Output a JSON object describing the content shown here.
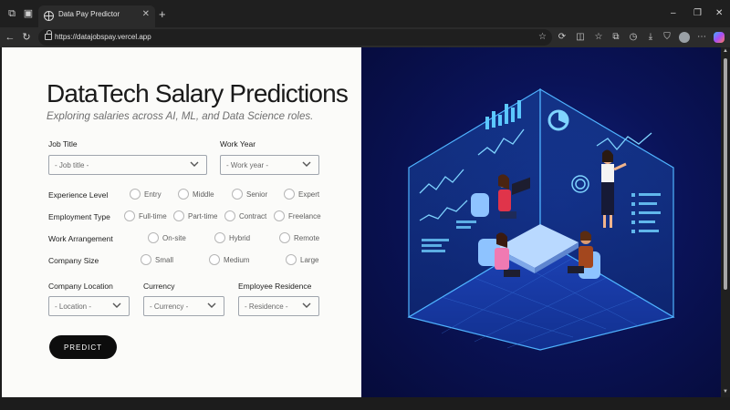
{
  "browser": {
    "tab_title": "Data Pay Predictor",
    "url": "https://datajobspay.vercel.app"
  },
  "page": {
    "title": "DataTech Salary Predictions",
    "subtitle": "Exploring salaries across AI, ML, and Data Science roles.",
    "job_title": {
      "label": "Job Title",
      "placeholder": "- Job title -"
    },
    "work_year": {
      "label": "Work Year",
      "placeholder": "- Work year -"
    },
    "experience": {
      "label": "Experience Level",
      "options": [
        "Entry",
        "Middle",
        "Senior",
        "Expert"
      ]
    },
    "employment": {
      "label": "Employment Type",
      "options": [
        "Full-time",
        "Part-time",
        "Contract",
        "Freelance"
      ]
    },
    "arrangement": {
      "label": "Work Arrangement",
      "options": [
        "On-site",
        "Hybrid",
        "Remote"
      ]
    },
    "company_size": {
      "label": "Company Size",
      "options": [
        "Small",
        "Medium",
        "Large"
      ]
    },
    "company_location": {
      "label": "Company Location",
      "placeholder": "- Location -"
    },
    "currency": {
      "label": "Currency",
      "placeholder": "- Currency -"
    },
    "residence": {
      "label": "Employee Residence",
      "placeholder": "- Residence -"
    },
    "predict_label": "PREDICT"
  },
  "colors": {
    "panel_bg": "#fbfbf9",
    "button_bg": "#0d0d0d",
    "illustration_bg": "#0a1358",
    "illustration_glow": "#2f9bff"
  }
}
